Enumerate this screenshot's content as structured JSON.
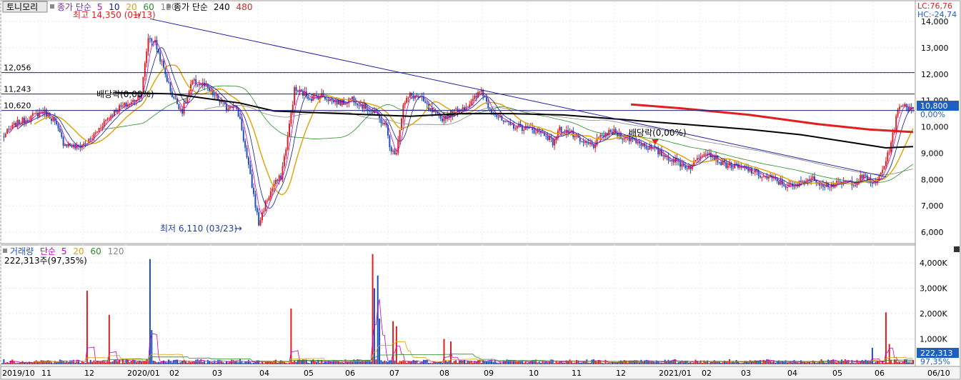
{
  "title_box": "토니모리",
  "legend_price": {
    "ma_label": "종가 단순",
    "periods": [
      "5",
      "10",
      "20",
      "60",
      "120"
    ],
    "ma2_label": "종가 단순",
    "periods2": [
      "240",
      "480"
    ]
  },
  "legend_volume": {
    "label": "거래량",
    "ma_label": "단순",
    "periods": [
      "5",
      "20",
      "60",
      "120"
    ],
    "current": "222,313주(97,35%)"
  },
  "header_right": {
    "lc": "LC:76,76",
    "hc": "HC:-24,74"
  },
  "annotations": {
    "high": "최고 14,350 (01/13)",
    "low": "최저 6,110 (03/23)",
    "dividend1": "배당락(0,00%)",
    "dividend2": "배당락(0,00%)"
  },
  "price_now": {
    "value": "10,800",
    "pct": "0,00%"
  },
  "volume_now": {
    "value": "222,313",
    "pct": "97,35%"
  },
  "colors": {
    "up": "#e02020",
    "down": "#1f4fbf",
    "ma5": "#c000c0",
    "ma10": "#0a1a9a",
    "ma20": "#e0a000",
    "ma60": "#2a8a2a",
    "ma120": "#888888",
    "ma240": "#000000",
    "ma480": "#e02020",
    "line": "#2020a0",
    "badge": "#1f5fbf"
  },
  "chart_data": {
    "type": "candlestick",
    "price_axis": {
      "min": 6000,
      "max": 14000,
      "ticks": [
        "14,000",
        "13,000",
        "12,000",
        "11,000",
        "10,000",
        "9,000",
        "8,000",
        "7,000",
        "6,000"
      ]
    },
    "volume_axis": {
      "min": 0,
      "max": 4000,
      "ticks": [
        "4,000K",
        "3,000K",
        "2,000K",
        "1,000K"
      ]
    },
    "x_labels": [
      "2019/10",
      "11",
      "12",
      "2020/01",
      "02",
      "03",
      "04",
      "05",
      "06",
      "07",
      "08",
      "09",
      "10",
      "11",
      "12",
      "2021/01",
      "02",
      "03",
      "04",
      "05",
      "06",
      "06/10"
    ],
    "h_lines": [
      {
        "label": "12,056",
        "value": 12056
      },
      {
        "label": "11,243",
        "value": 11243
      },
      {
        "label": "10,620",
        "value": 10620
      }
    ],
    "price_anchors": [
      [
        0,
        9600
      ],
      [
        8,
        10100
      ],
      [
        18,
        10400
      ],
      [
        24,
        10600
      ],
      [
        30,
        10300
      ],
      [
        36,
        9400
      ],
      [
        44,
        9200
      ],
      [
        52,
        9500
      ],
      [
        60,
        10200
      ],
      [
        68,
        10700
      ],
      [
        76,
        10900
      ],
      [
        82,
        11300
      ],
      [
        86,
        13400
      ],
      [
        90,
        13200
      ],
      [
        94,
        12400
      ],
      [
        100,
        11200
      ],
      [
        106,
        10600
      ],
      [
        112,
        11700
      ],
      [
        118,
        11600
      ],
      [
        126,
        11100
      ],
      [
        132,
        10700
      ],
      [
        136,
        10900
      ],
      [
        140,
        10300
      ],
      [
        144,
        8800
      ],
      [
        148,
        7400
      ],
      [
        151,
        6300
      ],
      [
        155,
        7100
      ],
      [
        160,
        7800
      ],
      [
        164,
        8100
      ],
      [
        168,
        9600
      ],
      [
        172,
        11400
      ],
      [
        176,
        11300
      ],
      [
        182,
        11100
      ],
      [
        188,
        11200
      ],
      [
        194,
        11000
      ],
      [
        200,
        10900
      ],
      [
        206,
        11100
      ],
      [
        212,
        10800
      ],
      [
        218,
        10600
      ],
      [
        222,
        10300
      ],
      [
        226,
        10000
      ],
      [
        229,
        9000
      ],
      [
        232,
        9100
      ],
      [
        236,
        10800
      ],
      [
        240,
        11200
      ],
      [
        246,
        11100
      ],
      [
        252,
        10600
      ],
      [
        258,
        10300
      ],
      [
        264,
        10500
      ],
      [
        270,
        10700
      ],
      [
        276,
        10900
      ],
      [
        282,
        11400
      ],
      [
        286,
        10800
      ],
      [
        290,
        10500
      ],
      [
        296,
        10100
      ],
      [
        304,
        10000
      ],
      [
        312,
        9900
      ],
      [
        320,
        9700
      ],
      [
        324,
        9400
      ],
      [
        328,
        9900
      ],
      [
        334,
        9800
      ],
      [
        340,
        9400
      ],
      [
        348,
        9300
      ],
      [
        354,
        9700
      ],
      [
        360,
        9800
      ],
      [
        366,
        9600
      ],
      [
        372,
        9500
      ],
      [
        378,
        9300
      ],
      [
        384,
        9100
      ],
      [
        390,
        8900
      ],
      [
        396,
        8700
      ],
      [
        402,
        8500
      ],
      [
        406,
        8500
      ],
      [
        410,
        8900
      ],
      [
        414,
        9100
      ],
      [
        418,
        8900
      ],
      [
        424,
        8600
      ],
      [
        430,
        8500
      ],
      [
        436,
        8400
      ],
      [
        442,
        8300
      ],
      [
        448,
        8100
      ],
      [
        454,
        8000
      ],
      [
        460,
        7800
      ],
      [
        466,
        7700
      ],
      [
        472,
        8000
      ],
      [
        478,
        8000
      ],
      [
        484,
        7800
      ],
      [
        490,
        7800
      ],
      [
        496,
        7900
      ],
      [
        502,
        7900
      ],
      [
        506,
        8100
      ],
      [
        510,
        8000
      ],
      [
        514,
        7800
      ],
      [
        518,
        8400
      ],
      [
        521,
        8900
      ],
      [
        524,
        9700
      ],
      [
        527,
        10600
      ],
      [
        530,
        10900
      ],
      [
        533,
        10700
      ],
      [
        536,
        10800
      ]
    ],
    "volume_spikes": [
      [
        50,
        2900
      ],
      [
        63,
        1950
      ],
      [
        87,
        4150
      ],
      [
        88,
        1350
      ],
      [
        170,
        2200
      ],
      [
        218,
        4350
      ],
      [
        219,
        3000
      ],
      [
        221,
        3500
      ],
      [
        222,
        1800
      ],
      [
        230,
        1700
      ],
      [
        232,
        1500
      ],
      [
        260,
        1000
      ],
      [
        264,
        900
      ],
      [
        512,
        650
      ],
      [
        520,
        2050
      ],
      [
        522,
        800
      ]
    ],
    "ma240_anchors": [
      [
        66,
        11300
      ],
      [
        100,
        11250
      ],
      [
        140,
        10900
      ],
      [
        160,
        10600
      ],
      [
        200,
        10500
      ],
      [
        240,
        10400
      ],
      [
        270,
        10500
      ],
      [
        300,
        10500
      ],
      [
        330,
        10450
      ],
      [
        360,
        10300
      ],
      [
        400,
        10100
      ],
      [
        440,
        9900
      ],
      [
        470,
        9700
      ],
      [
        500,
        9400
      ],
      [
        520,
        9200
      ],
      [
        536,
        9250
      ]
    ],
    "ma480_anchors": [
      [
        370,
        10850
      ],
      [
        400,
        10700
      ],
      [
        440,
        10450
      ],
      [
        480,
        10100
      ],
      [
        510,
        9900
      ],
      [
        536,
        9800
      ]
    ],
    "trendline": {
      "from": [
        87,
        14100
      ],
      "to": [
        520,
        8100
      ]
    }
  }
}
